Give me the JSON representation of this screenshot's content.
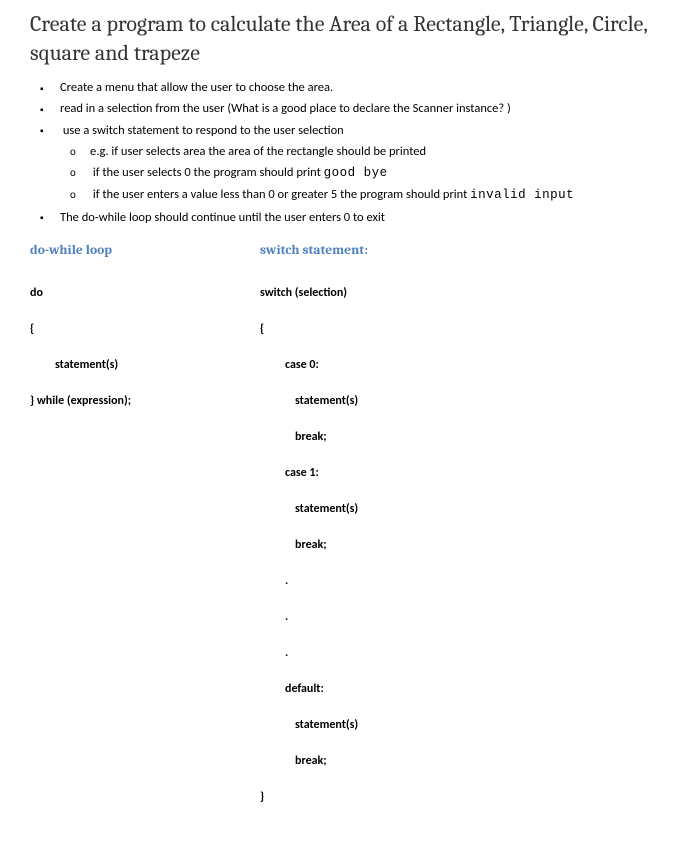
{
  "title": "Create a program to calculate the Area of a Rectangle, Triangle, Circle, square and trapeze",
  "bullets": {
    "b1": "Create a menu that allow the user to choose the area.",
    "b2": "read in a selection from the user (What is a good place to declare the Scanner instance? )",
    "b3": "use a switch statement to respond to the user selection",
    "b3a": "e.g. if user selects area the area of the rectangle should be printed",
    "b3b_pre": "if the user selects 0 the program should print ",
    "b3b_code": "good bye",
    "b3c_pre": "if the user enters a value less than 0 or greater 5 the program should print ",
    "b3c_code": "invalid input",
    "b4": "The do-while loop should continue until the user enters 0 to exit"
  },
  "doWhile": {
    "heading": "do-while loop",
    "l1": "do",
    "l2": "{",
    "l3": "statement(s)",
    "l4": "} while (expression);"
  },
  "switchStmt": {
    "heading": "switch statement:",
    "l1": "switch (selection)",
    "l2": "{",
    "l3": "case 0:",
    "l4": "statement(s)",
    "l5": "break;",
    "l6": "case 1:",
    "l7": "statement(s)",
    "l8": "break;",
    "l9": ".",
    "l10": ".",
    "l11": ".",
    "l12": "default:",
    "l13": "statement(s)",
    "l14": "break;",
    "l15": "}"
  }
}
